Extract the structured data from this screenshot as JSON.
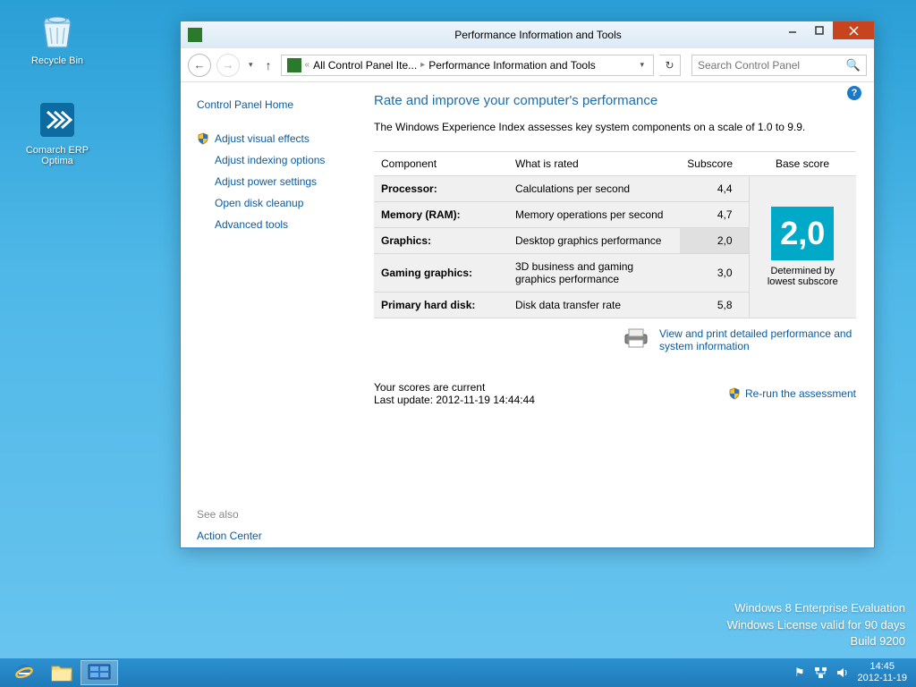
{
  "desktop": {
    "icons": [
      {
        "label": "Recycle Bin"
      },
      {
        "label": "Comarch ERP Optima"
      }
    ]
  },
  "window": {
    "title": "Performance Information and Tools",
    "breadcrumb": {
      "prefix": "«",
      "item1": "All Control Panel Ite...",
      "item2": "Performance Information and Tools"
    },
    "search_placeholder": "Search Control Panel"
  },
  "sidebar": {
    "home": "Control Panel Home",
    "links": [
      "Adjust visual effects",
      "Adjust indexing options",
      "Adjust power settings",
      "Open disk cleanup",
      "Advanced tools"
    ],
    "see_also_label": "See also",
    "see_also_link": "Action Center"
  },
  "main": {
    "heading": "Rate and improve your computer's performance",
    "description": "The Windows Experience Index assesses key system components on a scale of 1.0 to 9.9.",
    "headers": {
      "component": "Component",
      "rated": "What is rated",
      "subscore": "Subscore",
      "base": "Base score"
    },
    "rows": [
      {
        "label": "Processor:",
        "rated": "Calculations per second",
        "score": "4,4"
      },
      {
        "label": "Memory (RAM):",
        "rated": "Memory operations per second",
        "score": "4,7"
      },
      {
        "label": "Graphics:",
        "rated": "Desktop graphics performance",
        "score": "2,0",
        "highlight": true
      },
      {
        "label": "Gaming graphics:",
        "rated": "3D business and gaming graphics performance",
        "score": "3,0"
      },
      {
        "label": "Primary hard disk:",
        "rated": "Disk data transfer rate",
        "score": "5,8"
      }
    ],
    "base_score": "2,0",
    "base_score_label": "Determined by lowest subscore",
    "detail_link": "View and print detailed performance and system information",
    "status1": "Your scores are current",
    "status2": "Last update: 2012-11-19 14:44:44",
    "rerun": "Re-run the assessment"
  },
  "watermark": {
    "line1": "Windows 8 Enterprise Evaluation",
    "line2": "Windows License valid for 90 days",
    "line3": "Build 9200"
  },
  "taskbar": {
    "time": "14:45",
    "date": "2012-11-19"
  }
}
